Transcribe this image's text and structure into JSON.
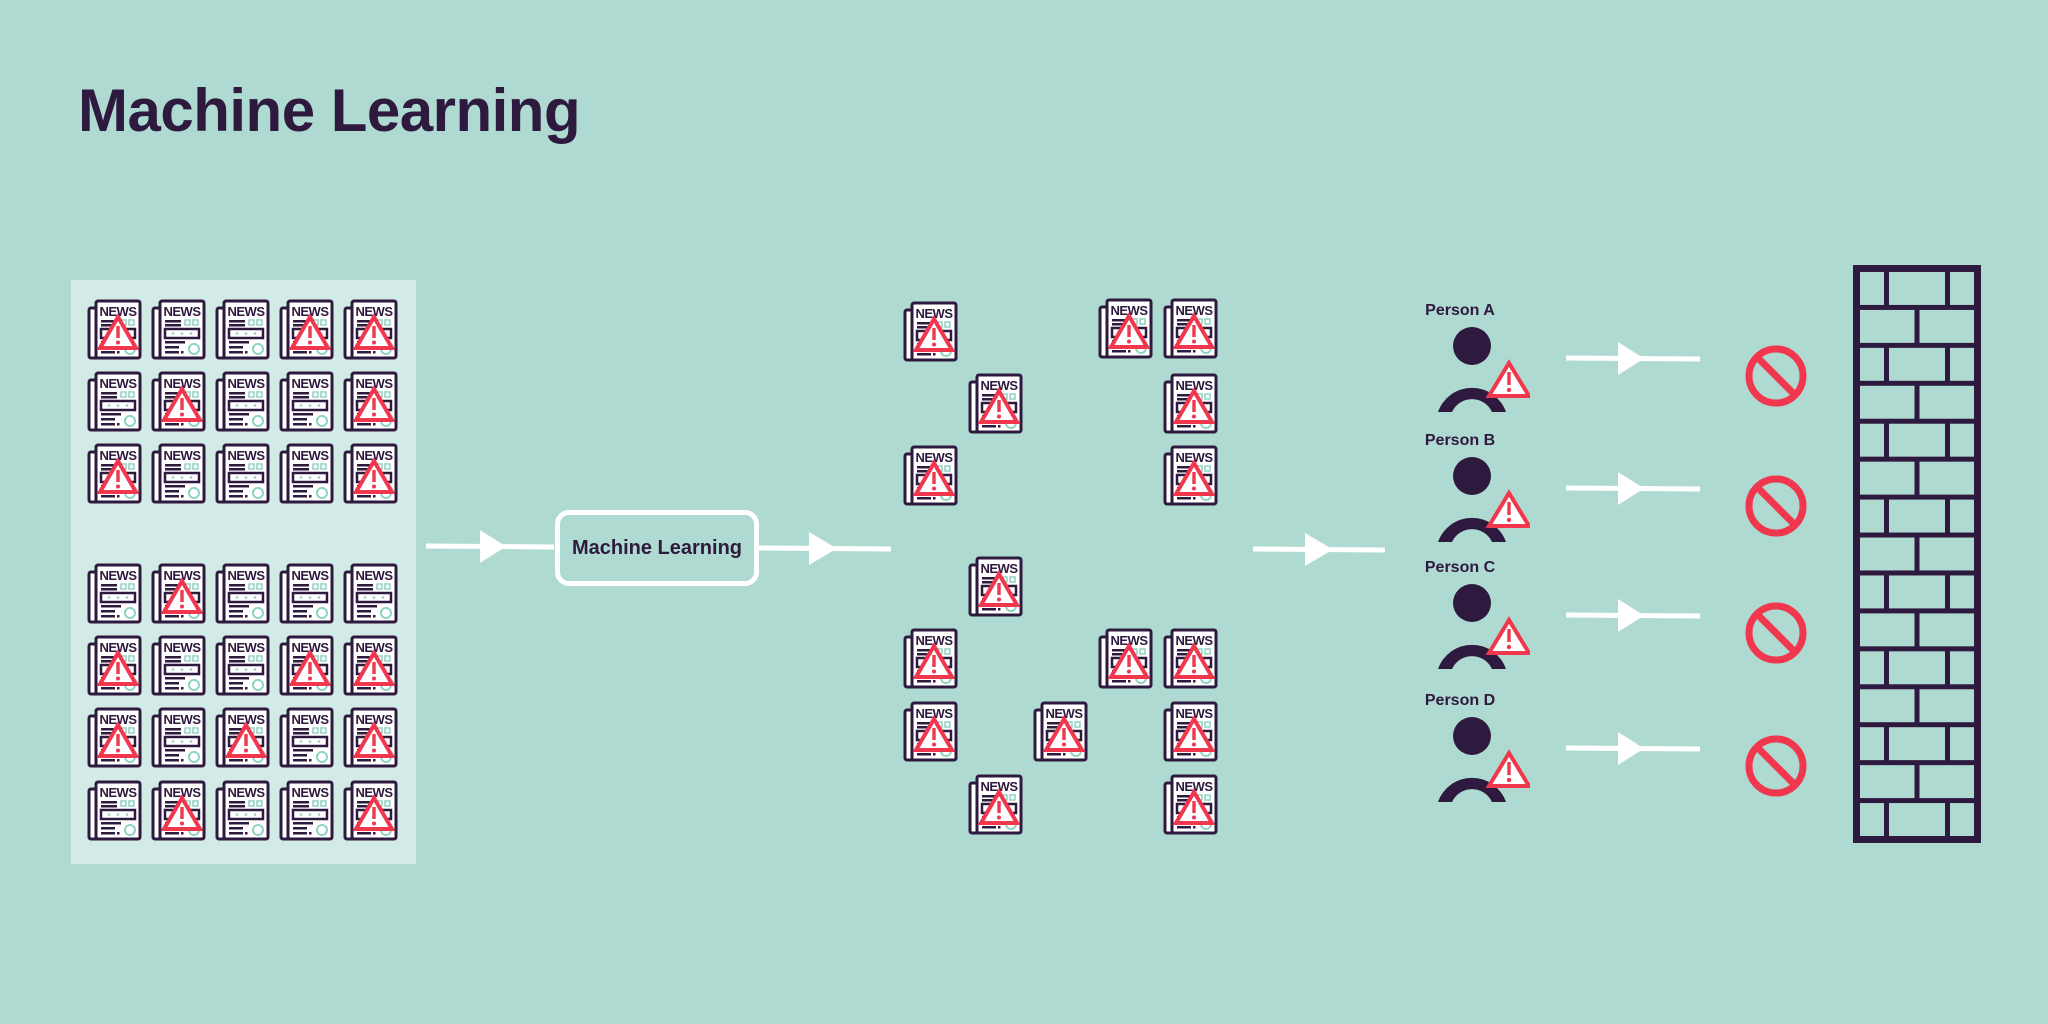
{
  "title": "Machine Learning",
  "colors": {
    "background": "#afdad1",
    "panel": "#d3ebe6",
    "ink": "#2e1a3e",
    "warning": "#f0374e",
    "accent": "#8fd3c2",
    "white": "#ffffff"
  },
  "input_panel": {
    "label": "news-articles-input",
    "groups": [
      {
        "rows": [
          [
            true,
            false,
            false,
            true,
            true
          ],
          [
            false,
            true,
            false,
            false,
            true
          ],
          [
            true,
            false,
            false,
            false,
            true
          ]
        ]
      },
      {
        "rows": [
          [
            false,
            true,
            false,
            false,
            false
          ],
          [
            true,
            false,
            false,
            true,
            true
          ],
          [
            true,
            false,
            true,
            false,
            true
          ],
          [
            false,
            true,
            false,
            false,
            true
          ]
        ]
      }
    ],
    "icon_text": "NEWS"
  },
  "process": {
    "label": "Machine Learning"
  },
  "flagged_output": {
    "icon_text": "NEWS",
    "count": 16
  },
  "people": [
    {
      "name": "Person A",
      "flagged": true,
      "blocked": true
    },
    {
      "name": "Person B",
      "flagged": true,
      "blocked": true
    },
    {
      "name": "Person C",
      "flagged": true,
      "blocked": true
    },
    {
      "name": "Person D",
      "flagged": true,
      "blocked": true
    }
  ],
  "icons": {
    "newspaper": "newspaper-icon",
    "warning": "warning-triangle-icon",
    "person": "person-icon",
    "arrow": "arrow-right-icon",
    "blocked": "no-entry-icon",
    "wall": "brick-wall-icon"
  }
}
